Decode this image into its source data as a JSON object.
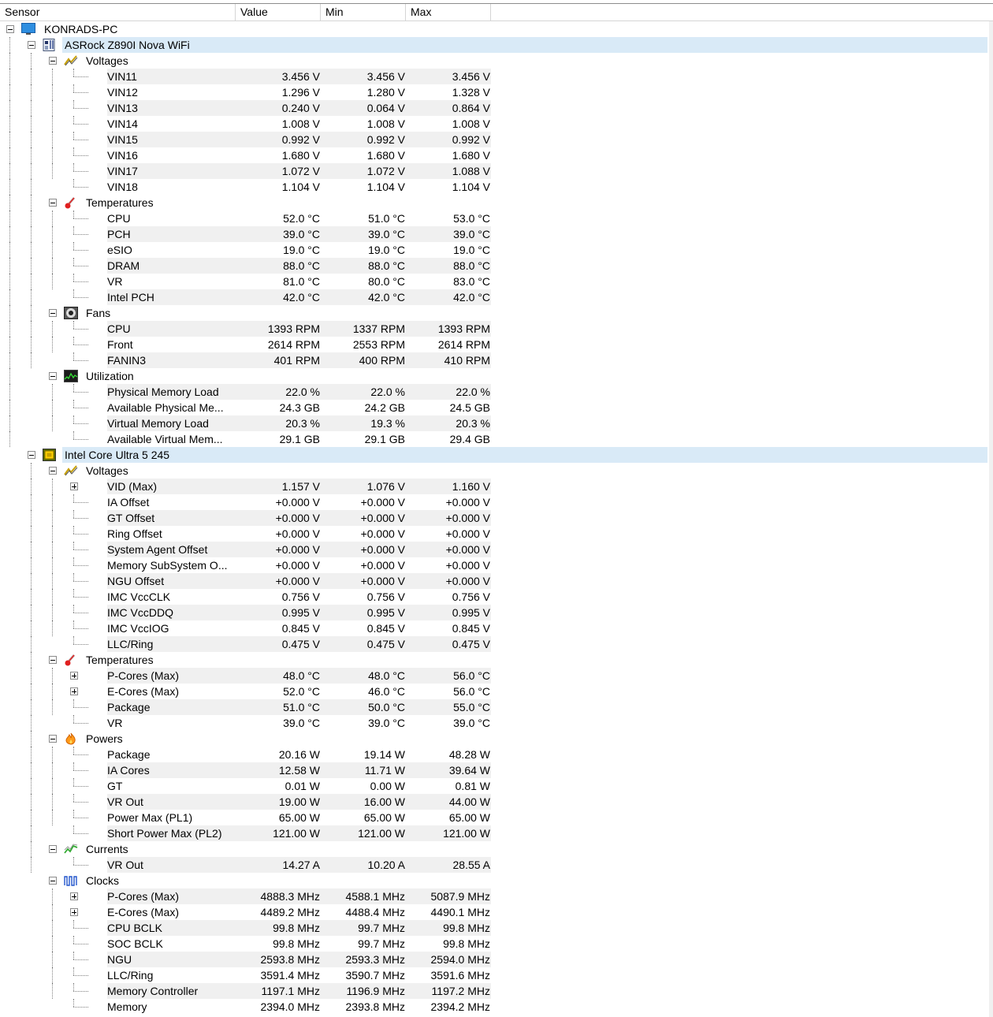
{
  "columns": [
    "Sensor",
    "Value",
    "Min",
    "Max"
  ],
  "tree": [
    {
      "level": 0,
      "type": "root",
      "label": "KONRADS-PC",
      "icon": "monitor-icon"
    },
    {
      "level": 1,
      "type": "device",
      "label": "ASRock Z890I Nova WiFi",
      "icon": "motherboard-icon",
      "highlight": true
    },
    {
      "level": 2,
      "type": "group",
      "label": "Voltages",
      "icon": "voltage-icon"
    },
    {
      "level": 3,
      "type": "sensor",
      "label": "VIN11",
      "value": "3.456 V",
      "min": "3.456 V",
      "max": "3.456 V"
    },
    {
      "level": 3,
      "type": "sensor",
      "label": "VIN12",
      "value": "1.296 V",
      "min": "1.280 V",
      "max": "1.328 V"
    },
    {
      "level": 3,
      "type": "sensor",
      "label": "VIN13",
      "value": "0.240 V",
      "min": "0.064 V",
      "max": "0.864 V"
    },
    {
      "level": 3,
      "type": "sensor",
      "label": "VIN14",
      "value": "1.008 V",
      "min": "1.008 V",
      "max": "1.008 V"
    },
    {
      "level": 3,
      "type": "sensor",
      "label": "VIN15",
      "value": "0.992 V",
      "min": "0.992 V",
      "max": "0.992 V"
    },
    {
      "level": 3,
      "type": "sensor",
      "label": "VIN16",
      "value": "1.680 V",
      "min": "1.680 V",
      "max": "1.680 V"
    },
    {
      "level": 3,
      "type": "sensor",
      "label": "VIN17",
      "value": "1.072 V",
      "min": "1.072 V",
      "max": "1.088 V"
    },
    {
      "level": 3,
      "type": "sensor",
      "label": "VIN18",
      "value": "1.104 V",
      "min": "1.104 V",
      "max": "1.104 V"
    },
    {
      "level": 2,
      "type": "group",
      "label": "Temperatures",
      "icon": "thermometer-icon"
    },
    {
      "level": 3,
      "type": "sensor",
      "label": "CPU",
      "value": "52.0 °C",
      "min": "51.0 °C",
      "max": "53.0 °C"
    },
    {
      "level": 3,
      "type": "sensor",
      "label": "PCH",
      "value": "39.0 °C",
      "min": "39.0 °C",
      "max": "39.0 °C"
    },
    {
      "level": 3,
      "type": "sensor",
      "label": "eSIO",
      "value": "19.0 °C",
      "min": "19.0 °C",
      "max": "19.0 °C"
    },
    {
      "level": 3,
      "type": "sensor",
      "label": "DRAM",
      "value": "88.0 °C",
      "min": "88.0 °C",
      "max": "88.0 °C"
    },
    {
      "level": 3,
      "type": "sensor",
      "label": "VR",
      "value": "81.0 °C",
      "min": "80.0 °C",
      "max": "83.0 °C"
    },
    {
      "level": 3,
      "type": "sensor",
      "label": "Intel PCH",
      "value": "42.0 °C",
      "min": "42.0 °C",
      "max": "42.0 °C"
    },
    {
      "level": 2,
      "type": "group",
      "label": "Fans",
      "icon": "fan-icon"
    },
    {
      "level": 3,
      "type": "sensor",
      "label": "CPU",
      "value": "1393 RPM",
      "min": "1337 RPM",
      "max": "1393 RPM"
    },
    {
      "level": 3,
      "type": "sensor",
      "label": "Front",
      "value": "2614 RPM",
      "min": "2553 RPM",
      "max": "2614 RPM"
    },
    {
      "level": 3,
      "type": "sensor",
      "label": "FANIN3",
      "value": "401 RPM",
      "min": "400 RPM",
      "max": "410 RPM"
    },
    {
      "level": 2,
      "type": "group",
      "label": "Utilization",
      "icon": "utilization-icon"
    },
    {
      "level": 3,
      "type": "sensor",
      "label": "Physical Memory Load",
      "value": "22.0 %",
      "min": "22.0 %",
      "max": "22.0 %"
    },
    {
      "level": 3,
      "type": "sensor",
      "label": "Available Physical Me...",
      "value": "24.3 GB",
      "min": "24.2 GB",
      "max": "24.5 GB"
    },
    {
      "level": 3,
      "type": "sensor",
      "label": "Virtual Memory Load",
      "value": "20.3 %",
      "min": "19.3 %",
      "max": "20.3 %"
    },
    {
      "level": 3,
      "type": "sensor",
      "label": "Available Virtual Mem...",
      "value": "29.1 GB",
      "min": "29.1 GB",
      "max": "29.4 GB"
    },
    {
      "level": 1,
      "type": "device",
      "label": "Intel Core Ultra 5 245",
      "icon": "cpu-chip-icon",
      "highlight": true
    },
    {
      "level": 2,
      "type": "group",
      "label": "Voltages",
      "icon": "voltage-icon"
    },
    {
      "level": 3,
      "type": "sensor",
      "label": "VID (Max)",
      "value": "1.157 V",
      "min": "1.076 V",
      "max": "1.160 V",
      "expandable": true
    },
    {
      "level": 3,
      "type": "sensor",
      "label": "IA Offset",
      "value": "+0.000 V",
      "min": "+0.000 V",
      "max": "+0.000 V"
    },
    {
      "level": 3,
      "type": "sensor",
      "label": "GT Offset",
      "value": "+0.000 V",
      "min": "+0.000 V",
      "max": "+0.000 V"
    },
    {
      "level": 3,
      "type": "sensor",
      "label": "Ring Offset",
      "value": "+0.000 V",
      "min": "+0.000 V",
      "max": "+0.000 V"
    },
    {
      "level": 3,
      "type": "sensor",
      "label": "System Agent Offset",
      "value": "+0.000 V",
      "min": "+0.000 V",
      "max": "+0.000 V"
    },
    {
      "level": 3,
      "type": "sensor",
      "label": "Memory SubSystem O...",
      "value": "+0.000 V",
      "min": "+0.000 V",
      "max": "+0.000 V"
    },
    {
      "level": 3,
      "type": "sensor",
      "label": "NGU Offset",
      "value": "+0.000 V",
      "min": "+0.000 V",
      "max": "+0.000 V"
    },
    {
      "level": 3,
      "type": "sensor",
      "label": "IMC VccCLK",
      "value": "0.756 V",
      "min": "0.756 V",
      "max": "0.756 V"
    },
    {
      "level": 3,
      "type": "sensor",
      "label": "IMC VccDDQ",
      "value": "0.995 V",
      "min": "0.995 V",
      "max": "0.995 V"
    },
    {
      "level": 3,
      "type": "sensor",
      "label": "IMC VccIOG",
      "value": "0.845 V",
      "min": "0.845 V",
      "max": "0.845 V"
    },
    {
      "level": 3,
      "type": "sensor",
      "label": "LLC/Ring",
      "value": "0.475 V",
      "min": "0.475 V",
      "max": "0.475 V"
    },
    {
      "level": 2,
      "type": "group",
      "label": "Temperatures",
      "icon": "thermometer-icon"
    },
    {
      "level": 3,
      "type": "sensor",
      "label": "P-Cores (Max)",
      "value": "48.0 °C",
      "min": "48.0 °C",
      "max": "56.0 °C",
      "expandable": true
    },
    {
      "level": 3,
      "type": "sensor",
      "label": "E-Cores (Max)",
      "value": "52.0 °C",
      "min": "46.0 °C",
      "max": "56.0 °C",
      "expandable": true
    },
    {
      "level": 3,
      "type": "sensor",
      "label": "Package",
      "value": "51.0 °C",
      "min": "50.0 °C",
      "max": "55.0 °C"
    },
    {
      "level": 3,
      "type": "sensor",
      "label": "VR",
      "value": "39.0 °C",
      "min": "39.0 °C",
      "max": "39.0 °C"
    },
    {
      "level": 2,
      "type": "group",
      "label": "Powers",
      "icon": "flame-icon"
    },
    {
      "level": 3,
      "type": "sensor",
      "label": "Package",
      "value": "20.16 W",
      "min": "19.14 W",
      "max": "48.28 W"
    },
    {
      "level": 3,
      "type": "sensor",
      "label": "IA Cores",
      "value": "12.58 W",
      "min": "11.71 W",
      "max": "39.64 W"
    },
    {
      "level": 3,
      "type": "sensor",
      "label": "GT",
      "value": "0.01 W",
      "min": "0.00 W",
      "max": "0.81 W"
    },
    {
      "level": 3,
      "type": "sensor",
      "label": "VR Out",
      "value": "19.00 W",
      "min": "16.00 W",
      "max": "44.00 W"
    },
    {
      "level": 3,
      "type": "sensor",
      "label": "Power Max (PL1)",
      "value": "65.00 W",
      "min": "65.00 W",
      "max": "65.00 W"
    },
    {
      "level": 3,
      "type": "sensor",
      "label": "Short Power Max (PL2)",
      "value": "121.00 W",
      "min": "121.00 W",
      "max": "121.00 W"
    },
    {
      "level": 2,
      "type": "group",
      "label": "Currents",
      "icon": "current-icon"
    },
    {
      "level": 3,
      "type": "sensor",
      "label": "VR Out",
      "value": "14.27 A",
      "min": "10.20 A",
      "max": "28.55 A"
    },
    {
      "level": 2,
      "type": "group",
      "label": "Clocks",
      "icon": "clock-wave-icon"
    },
    {
      "level": 3,
      "type": "sensor",
      "label": "P-Cores (Max)",
      "value": "4888.3 MHz",
      "min": "4588.1 MHz",
      "max": "5087.9 MHz",
      "expandable": true
    },
    {
      "level": 3,
      "type": "sensor",
      "label": "E-Cores (Max)",
      "value": "4489.2 MHz",
      "min": "4488.4 MHz",
      "max": "4490.1 MHz",
      "expandable": true
    },
    {
      "level": 3,
      "type": "sensor",
      "label": "CPU BCLK",
      "value": "99.8 MHz",
      "min": "99.7 MHz",
      "max": "99.8 MHz"
    },
    {
      "level": 3,
      "type": "sensor",
      "label": "SOC BCLK",
      "value": "99.8 MHz",
      "min": "99.7 MHz",
      "max": "99.8 MHz"
    },
    {
      "level": 3,
      "type": "sensor",
      "label": "NGU",
      "value": "2593.8 MHz",
      "min": "2593.3 MHz",
      "max": "2594.0 MHz"
    },
    {
      "level": 3,
      "type": "sensor",
      "label": "LLC/Ring",
      "value": "3591.4 MHz",
      "min": "3590.7 MHz",
      "max": "3591.6 MHz"
    },
    {
      "level": 3,
      "type": "sensor",
      "label": "Memory Controller",
      "value": "1197.1 MHz",
      "min": "1196.9 MHz",
      "max": "1197.2 MHz"
    },
    {
      "level": 3,
      "type": "sensor",
      "label": "Memory",
      "value": "2394.0 MHz",
      "min": "2393.8 MHz",
      "max": "2394.2 MHz"
    }
  ],
  "colors": {
    "device_highlight": "#d9eaf7",
    "sensor_stripe": "#f0f0f0",
    "grid_line": "#d5d5d5"
  }
}
